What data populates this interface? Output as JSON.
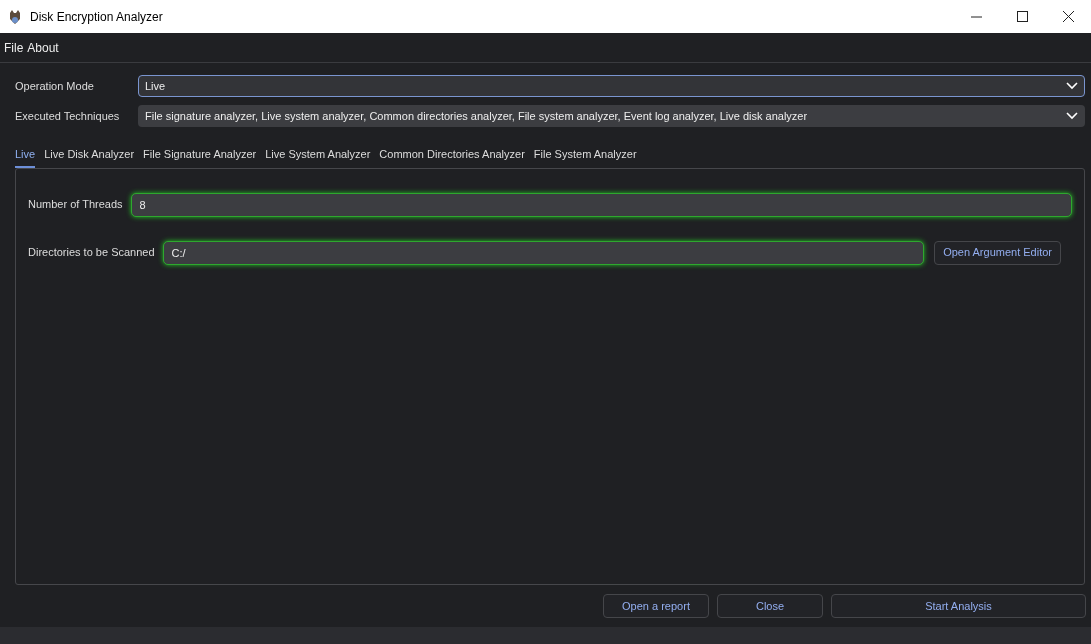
{
  "window": {
    "title": "Disk Encryption Analyzer"
  },
  "menu": [
    "File",
    "About"
  ],
  "operation_mode": {
    "label": "Operation Mode",
    "value": "Live"
  },
  "executed_techniques": {
    "label": "Executed Techniques",
    "value": "File signature analyzer, Live system analyzer, Common directories analyzer, File system analyzer, Event log analyzer, Live disk analyzer"
  },
  "tabs": [
    {
      "label": "Live",
      "selected": true
    },
    {
      "label": "Live Disk Analyzer",
      "selected": false
    },
    {
      "label": "File Signature Analyzer",
      "selected": false
    },
    {
      "label": "Live System Analyzer",
      "selected": false
    },
    {
      "label": "Common Directories Analyzer",
      "selected": false
    },
    {
      "label": "File System Analyzer",
      "selected": false
    }
  ],
  "fields": [
    {
      "label": "Number of Threads",
      "value": "8"
    },
    {
      "label": "Directories to be Scanned",
      "value": "C:/",
      "button": "Open Argument Editor"
    }
  ],
  "buttons": [
    "Open a report",
    "Close",
    "Start Analysis"
  ]
}
